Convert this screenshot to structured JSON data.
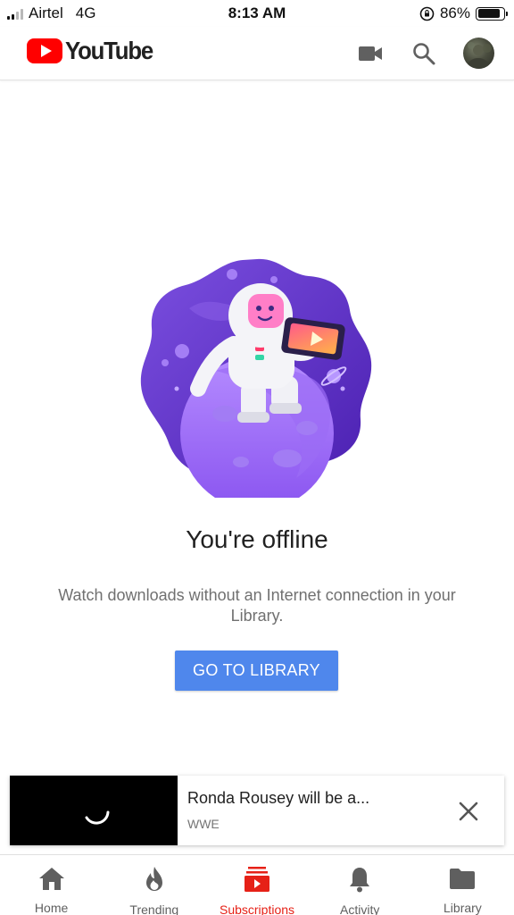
{
  "status_bar": {
    "carrier": "Airtel",
    "network": "4G",
    "time": "8:13 AM",
    "battery_percent": "86%",
    "battery_level": 0.86,
    "signal_bars": 2
  },
  "app_bar": {
    "logo_text": "YouTube",
    "icons": [
      "video-camera-icon",
      "search-icon"
    ],
    "brand_color": "#ff0000"
  },
  "offline": {
    "title": "You're offline",
    "message": "Watch downloads without an Internet connection in your Library.",
    "button_label": "GO TO LIBRARY",
    "button_color": "#4f87ec"
  },
  "mini_player": {
    "title": "Ronda Rousey will be a...",
    "channel": "WWE"
  },
  "bottom_nav": {
    "active_color": "#e62117",
    "items": [
      {
        "label": "Home",
        "icon": "home-icon",
        "active": false
      },
      {
        "label": "Trending",
        "icon": "flame-icon",
        "active": false
      },
      {
        "label": "Subscriptions",
        "icon": "subscriptions-icon",
        "active": true
      },
      {
        "label": "Activity",
        "icon": "bell-icon",
        "active": false
      },
      {
        "label": "Library",
        "icon": "folder-icon",
        "active": false
      }
    ]
  }
}
